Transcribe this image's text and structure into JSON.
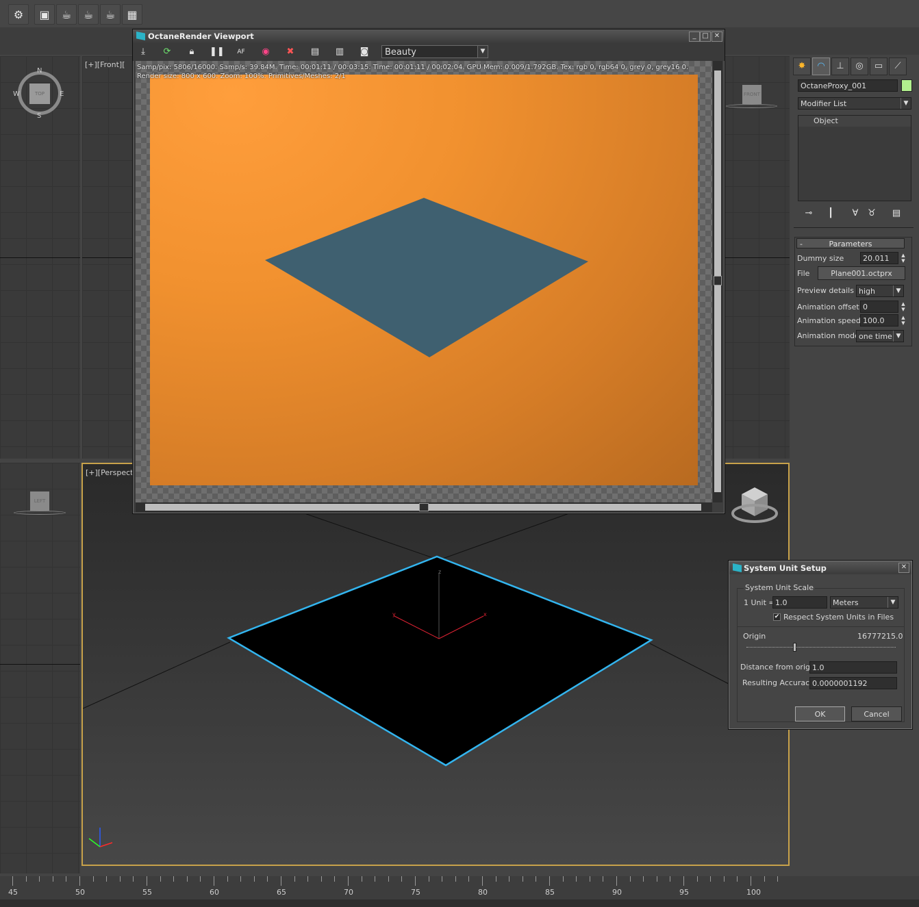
{
  "octane": {
    "title": "OctaneRender Viewport",
    "pass": "Beauty",
    "stats_line1": "Samp/pix: 5806/16000.   Samp/s: 39.84M.   Time: 00:01:11 / 00:03:15.   Time: 00:01:11 / 00:02:04.   GPU Mem: 0.009/1.792GB.   Tex: rgb 0, rgb64 0, grey 0, grey16 0.",
    "stats_line2": "Render size: 800 x 600.   Zoom: 100%.   Primitives/Meshes: 2/1"
  },
  "viewports": {
    "front_label": "[+][Front][",
    "persp_label": "[+][Perspect",
    "compass": {
      "n": "N",
      "s": "S",
      "e": "E",
      "w": "W",
      "top": "TOP"
    },
    "cube_front": "FRONT",
    "cube_left": "LEFT"
  },
  "command_panel": {
    "object_name": "OctaneProxy_001",
    "object_color": "#b2f08e",
    "modifier_list": "Modifier List",
    "stack_item": "Object",
    "rollout_minus": "-",
    "rollout_title": "Parameters",
    "dummy_size_label": "Dummy size",
    "dummy_size": "20.011",
    "file_label": "File",
    "file_value": "Plane001.octprx",
    "preview_details_label": "Preview details",
    "preview_details": "high",
    "anim_offset_label": "Animation offset",
    "anim_offset": "0",
    "anim_speed_label": "Animation speed",
    "anim_speed": "100.0",
    "anim_mode_label": "Animation mode",
    "anim_mode": "one time"
  },
  "unit_dialog": {
    "title": "System Unit Setup",
    "group": "System Unit Scale",
    "unit_label": "1 Unit =",
    "unit_value": "1.0",
    "unit_type": "Meters",
    "respect_label": "Respect System Units in Files",
    "respect_checked": true,
    "origin_label": "Origin",
    "origin_value": "16777215.0",
    "distance_label": "Distance from origin:",
    "distance_value": "1.0",
    "accuracy_label": "Resulting Accuracy:",
    "accuracy_value": "0.0000001192",
    "ok": "OK",
    "cancel": "Cancel"
  },
  "timeline": {
    "labels": [
      "45",
      "50",
      "55",
      "60",
      "65",
      "70",
      "75",
      "80",
      "85",
      "90",
      "95",
      "100"
    ]
  },
  "colors": {
    "selection_border": "#c8a24a",
    "plane_edge": "#33b5ef",
    "render_plane": "#3f6070"
  }
}
